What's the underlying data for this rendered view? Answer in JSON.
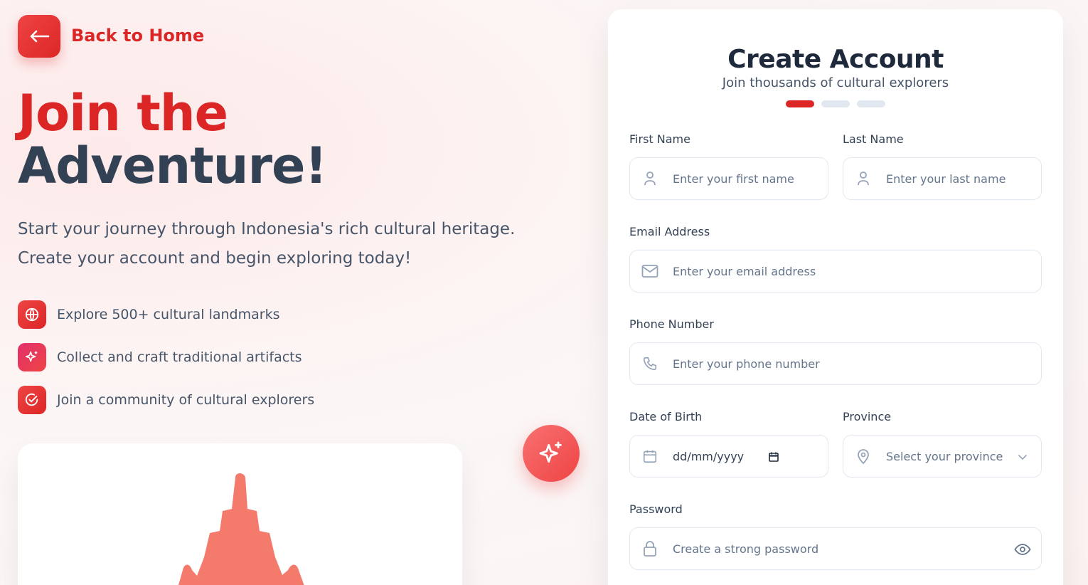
{
  "nav": {
    "back_label": "Back to Home"
  },
  "hero": {
    "title_line1": "Join the",
    "title_line2": "Adventure!",
    "description": "Start your journey through Indonesia's rich cultural heritage. Create your account and begin exploring today!"
  },
  "features": [
    {
      "icon": "globe-icon",
      "text": "Explore 500+ cultural landmarks"
    },
    {
      "icon": "sparkles-icon",
      "text": "Collect and craft traditional artifacts"
    },
    {
      "icon": "check-circle-icon",
      "text": "Join a community of cultural explorers"
    }
  ],
  "form": {
    "title": "Create Account",
    "subtitle": "Join thousands of cultural explorers",
    "steps_total": 3,
    "current_step": 1,
    "first_name": {
      "label": "First Name",
      "placeholder": "Enter your first name"
    },
    "last_name": {
      "label": "Last Name",
      "placeholder": "Enter your last name"
    },
    "email": {
      "label": "Email Address",
      "placeholder": "Enter your email address"
    },
    "phone": {
      "label": "Phone Number",
      "placeholder": "Enter your phone number"
    },
    "dob": {
      "label": "Date of Birth",
      "value": "dd/mm/yyyy"
    },
    "province": {
      "label": "Province",
      "placeholder": "Select your province"
    },
    "password": {
      "label": "Password",
      "placeholder": "Create a strong password"
    }
  },
  "colors": {
    "accent": "#dc2626",
    "heading": "#334155",
    "temple": "#f47a6b"
  }
}
